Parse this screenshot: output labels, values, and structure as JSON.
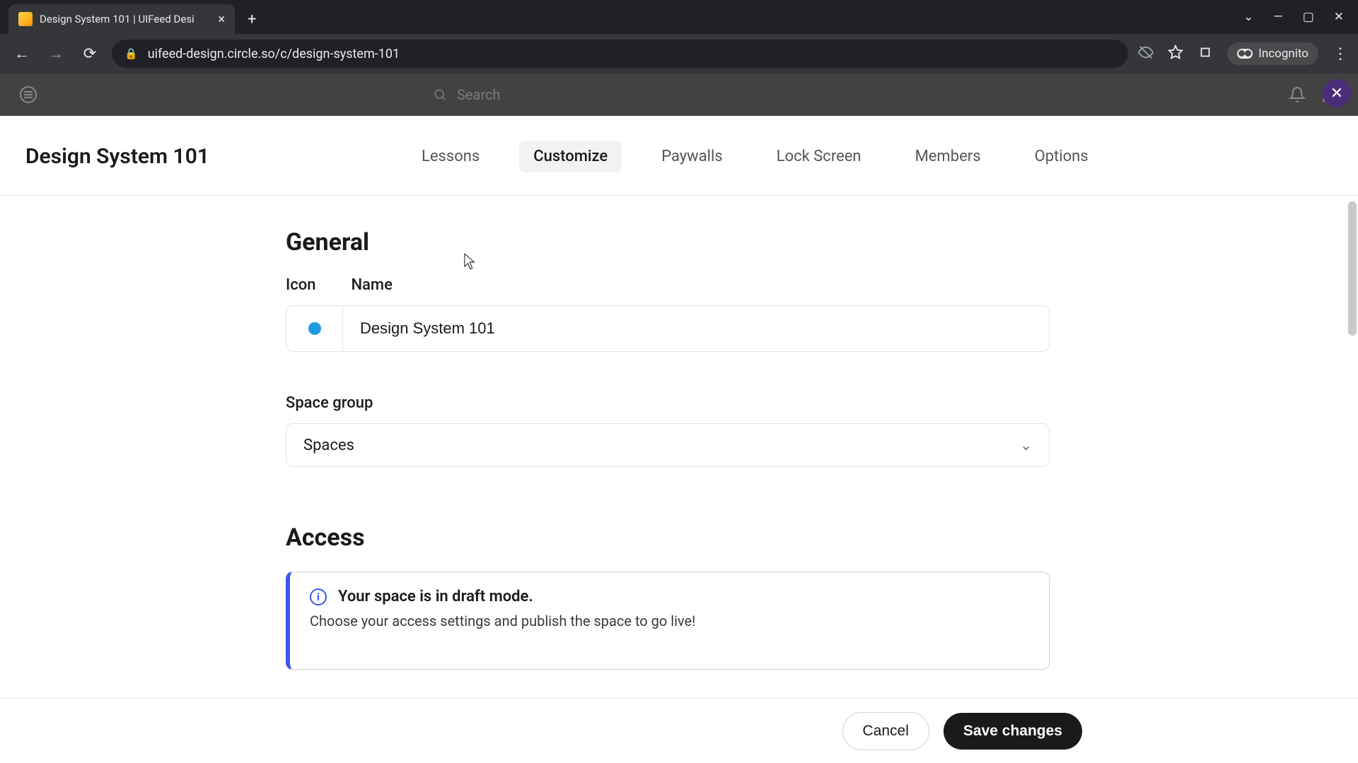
{
  "browser": {
    "tab_title": "Design System 101 | UIFeed Desi",
    "url": "uifeed-design.circle.so/c/design-system-101",
    "incognito_label": "Incognito"
  },
  "dim_header": {
    "search_placeholder": "Search"
  },
  "panel": {
    "title": "Design System 101",
    "tabs": [
      "Lessons",
      "Customize",
      "Paywalls",
      "Lock Screen",
      "Members",
      "Options"
    ],
    "active_tab": 1
  },
  "form": {
    "section_general": "General",
    "icon_label": "Icon",
    "name_label": "Name",
    "name_value": "Design System 101",
    "icon_color": "#1e9ae0",
    "space_group_label": "Space group",
    "space_group_value": "Spaces",
    "section_access": "Access",
    "banner_title": "Your space is in draft mode.",
    "banner_sub": "Choose your access settings and publish the space to go live!"
  },
  "footer": {
    "cancel": "Cancel",
    "save": "Save changes"
  }
}
